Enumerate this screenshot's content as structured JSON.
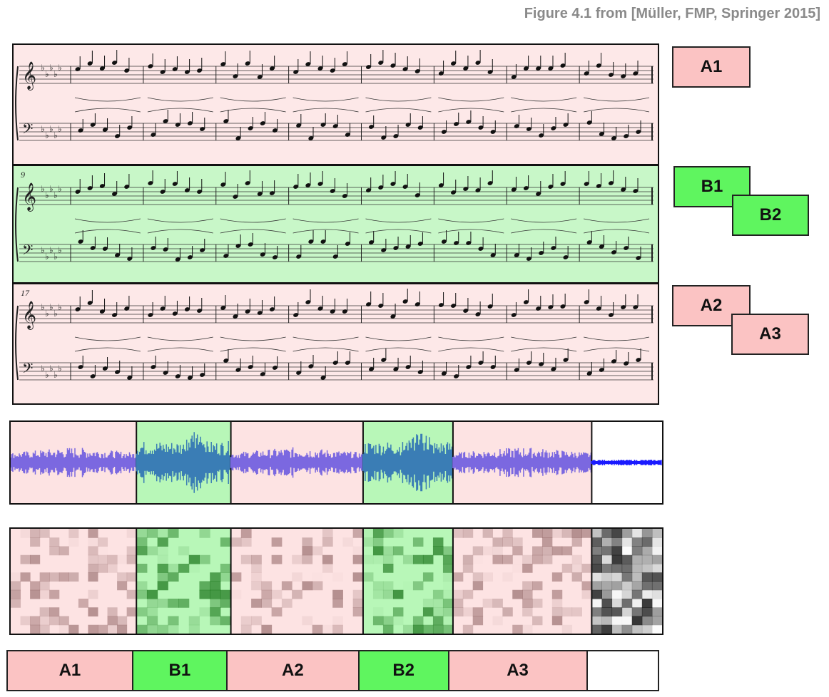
{
  "caption": "Figure 4.1 from [Müller, FMP, Springer 2015]",
  "score": {
    "systems": [
      {
        "label": "A1",
        "color": "#fde8e8",
        "measure_number": ""
      },
      {
        "label": "B1",
        "color": "#c8f7c8",
        "measure_number": "9"
      },
      {
        "label": "A2",
        "color": "#fde8e8",
        "measure_number": "17"
      }
    ]
  },
  "section_labels": {
    "a1": "A1",
    "b1": "B1",
    "b2": "B2",
    "a2": "A2",
    "a3": "A3"
  },
  "timeline": {
    "segments": [
      {
        "label": "A1",
        "kind": "A"
      },
      {
        "label": "B1",
        "kind": "B"
      },
      {
        "label": "A2",
        "kind": "A"
      },
      {
        "label": "B2",
        "kind": "B"
      },
      {
        "label": "A3",
        "kind": "A"
      },
      {
        "label": "",
        "kind": "silence"
      }
    ]
  },
  "colors": {
    "section_a": "#fbc3c3",
    "section_b": "#5ff55f",
    "section_a_light": "#fde3e3",
    "section_b_light": "#b8f7b8",
    "waveform_a": "#7b68e0",
    "waveform_b": "#3a7db5",
    "waveform_tail": "#1a1aff"
  }
}
